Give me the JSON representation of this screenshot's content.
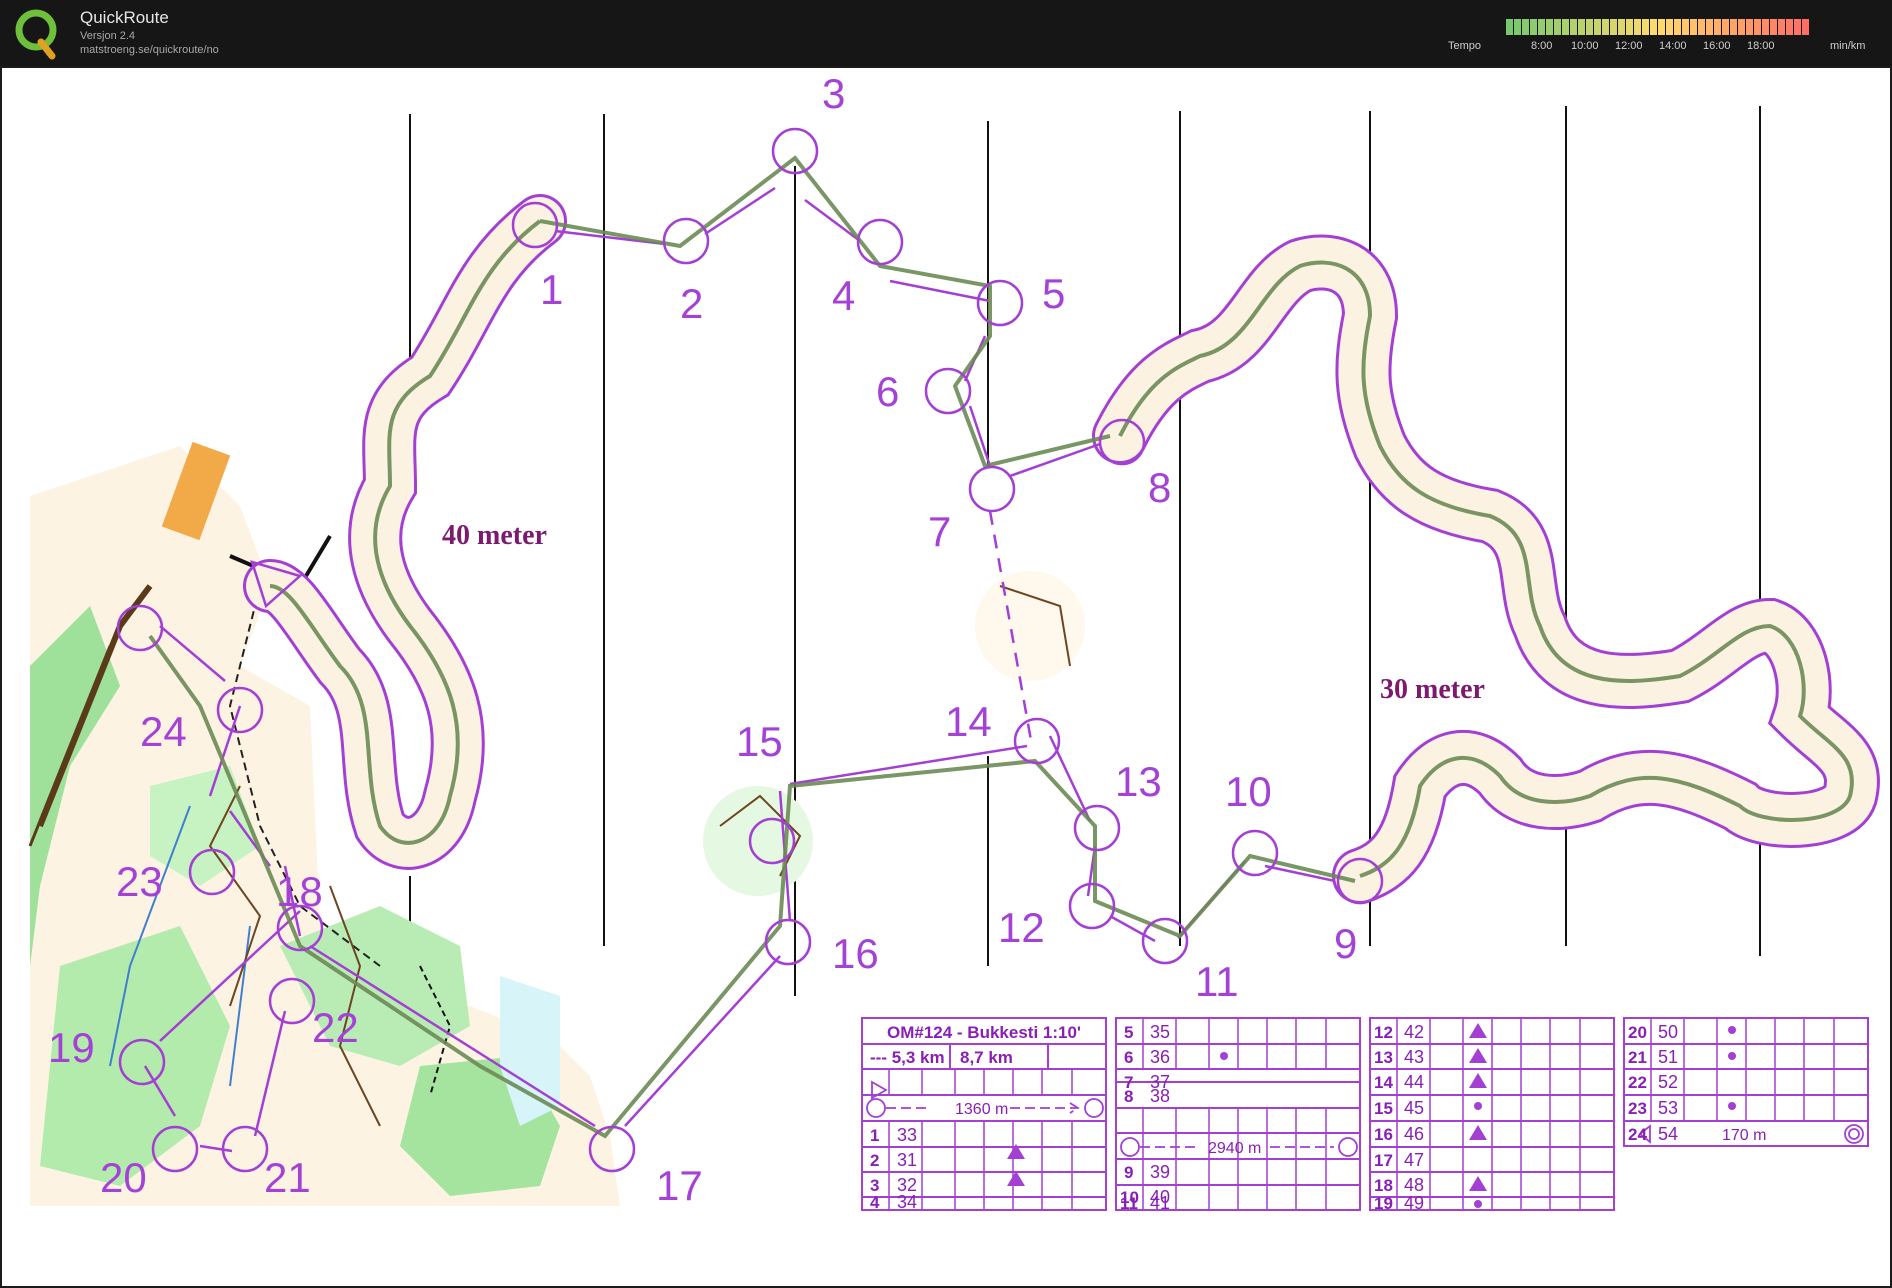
{
  "app": {
    "name": "QuickRoute",
    "version": "Versjon 2.4",
    "url": "matstroeng.se/quickroute/no"
  },
  "pace_legend": {
    "label": "Tempo",
    "ticks": [
      "8:00",
      "10:00",
      "12:00",
      "14:00",
      "16:00",
      "18:00"
    ],
    "unit": "min/km"
  },
  "map": {
    "annotations": [
      "40 meter",
      "30 meter"
    ],
    "controls": [
      "1",
      "2",
      "3",
      "4",
      "5",
      "6",
      "7",
      "8",
      "9",
      "10",
      "11",
      "12",
      "13",
      "14",
      "15",
      "16",
      "17",
      "18",
      "19",
      "20",
      "21",
      "22",
      "23",
      "24"
    ]
  },
  "colors": {
    "course": "#a33fd3",
    "route": "#5d7a4a",
    "control_label": "#a542d6"
  },
  "description_sheet": {
    "title": "OM#124 - Bukkesti 1:10'",
    "lengths": [
      "--- 5,3 km",
      "8,7 km"
    ],
    "marked_routes": [
      "1360 m",
      "2940 m",
      "170 m"
    ],
    "rows": [
      {
        "n": "1",
        "code": "33"
      },
      {
        "n": "2",
        "code": "31"
      },
      {
        "n": "3",
        "code": "32"
      },
      {
        "n": "4",
        "code": "34"
      },
      {
        "n": "5",
        "code": "35"
      },
      {
        "n": "6",
        "code": "36"
      },
      {
        "n": "7",
        "code": "37"
      },
      {
        "n": "8",
        "code": "38"
      },
      {
        "n": "9",
        "code": "39"
      },
      {
        "n": "10",
        "code": "40"
      },
      {
        "n": "11",
        "code": "41"
      },
      {
        "n": "12",
        "code": "42"
      },
      {
        "n": "13",
        "code": "43"
      },
      {
        "n": "14",
        "code": "44"
      },
      {
        "n": "15",
        "code": "45"
      },
      {
        "n": "16",
        "code": "46"
      },
      {
        "n": "17",
        "code": "47"
      },
      {
        "n": "18",
        "code": "48"
      },
      {
        "n": "19",
        "code": "49"
      },
      {
        "n": "20",
        "code": "50"
      },
      {
        "n": "21",
        "code": "51"
      },
      {
        "n": "22",
        "code": "52"
      },
      {
        "n": "23",
        "code": "53"
      },
      {
        "n": "24",
        "code": "54"
      }
    ]
  }
}
